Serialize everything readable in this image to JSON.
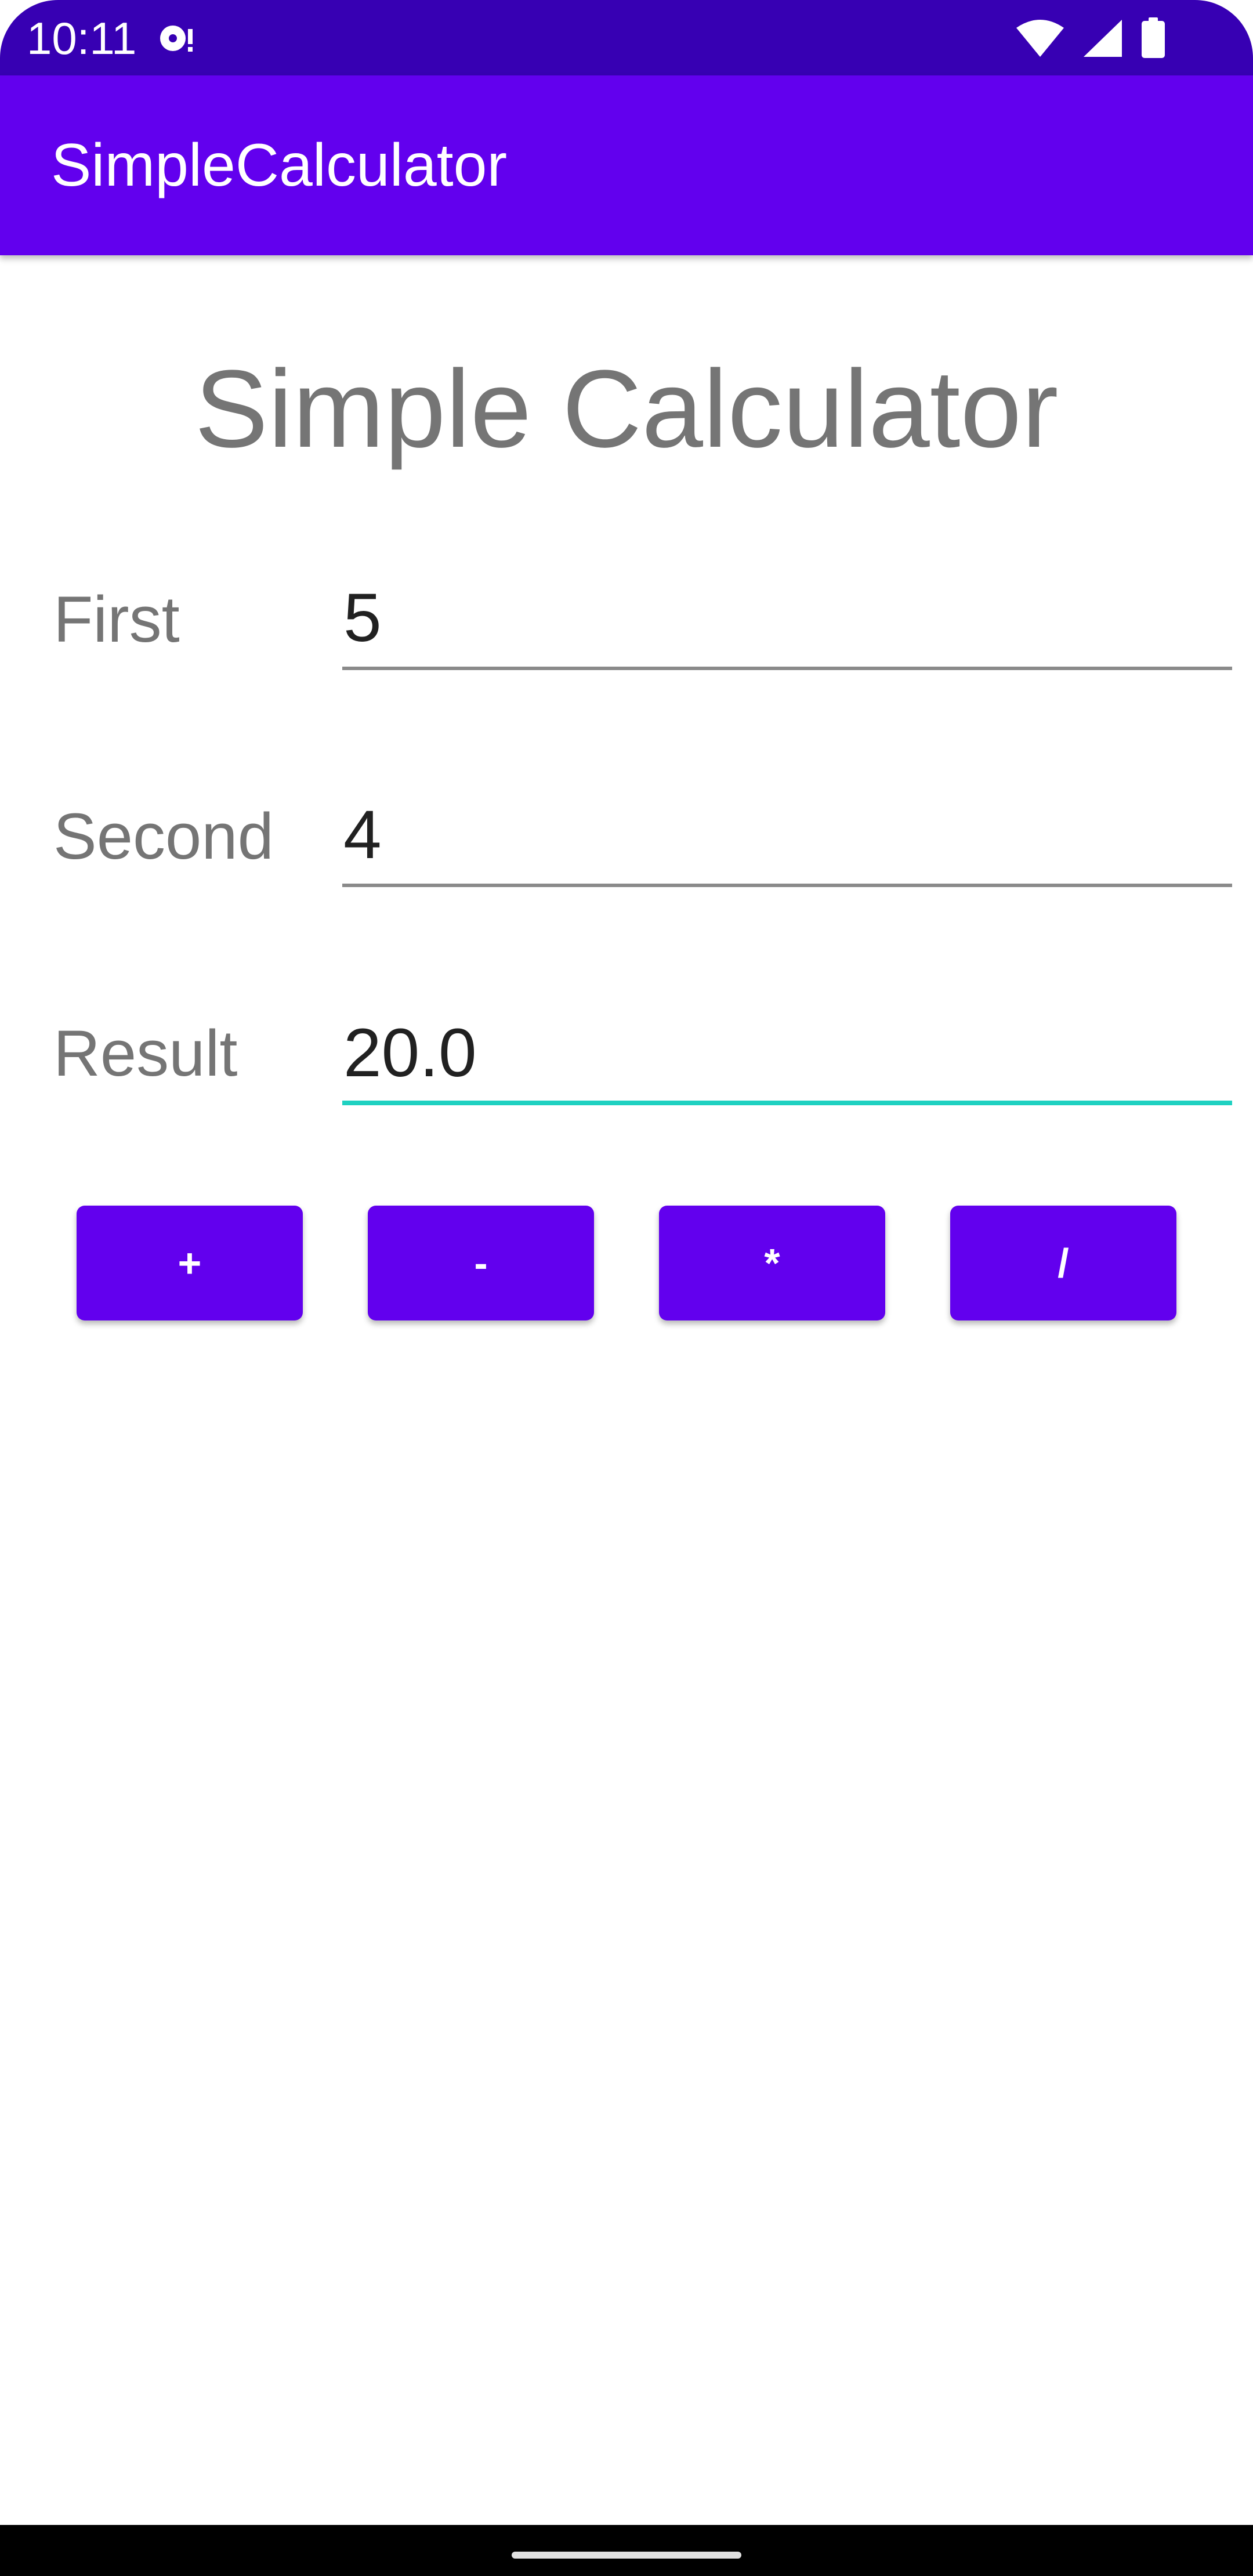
{
  "status_bar": {
    "time": "10:11",
    "icons": [
      "media-notification-icon",
      "wifi-icon",
      "signal-icon",
      "battery-icon"
    ]
  },
  "app_bar": {
    "title": "SimpleCalculator"
  },
  "main": {
    "heading": "Simple Calculator",
    "fields": [
      {
        "label": "First",
        "value": "5"
      },
      {
        "label": "Second",
        "value": "4"
      },
      {
        "label": "Result",
        "value": "20.0"
      }
    ],
    "buttons": [
      {
        "label": "+"
      },
      {
        "label": "-"
      },
      {
        "label": "*"
      },
      {
        "label": "/"
      }
    ]
  },
  "colors": {
    "status_bar": "#3700b3",
    "primary": "#6200ee",
    "accent": "#1fd1c1",
    "label_text": "#757575"
  }
}
